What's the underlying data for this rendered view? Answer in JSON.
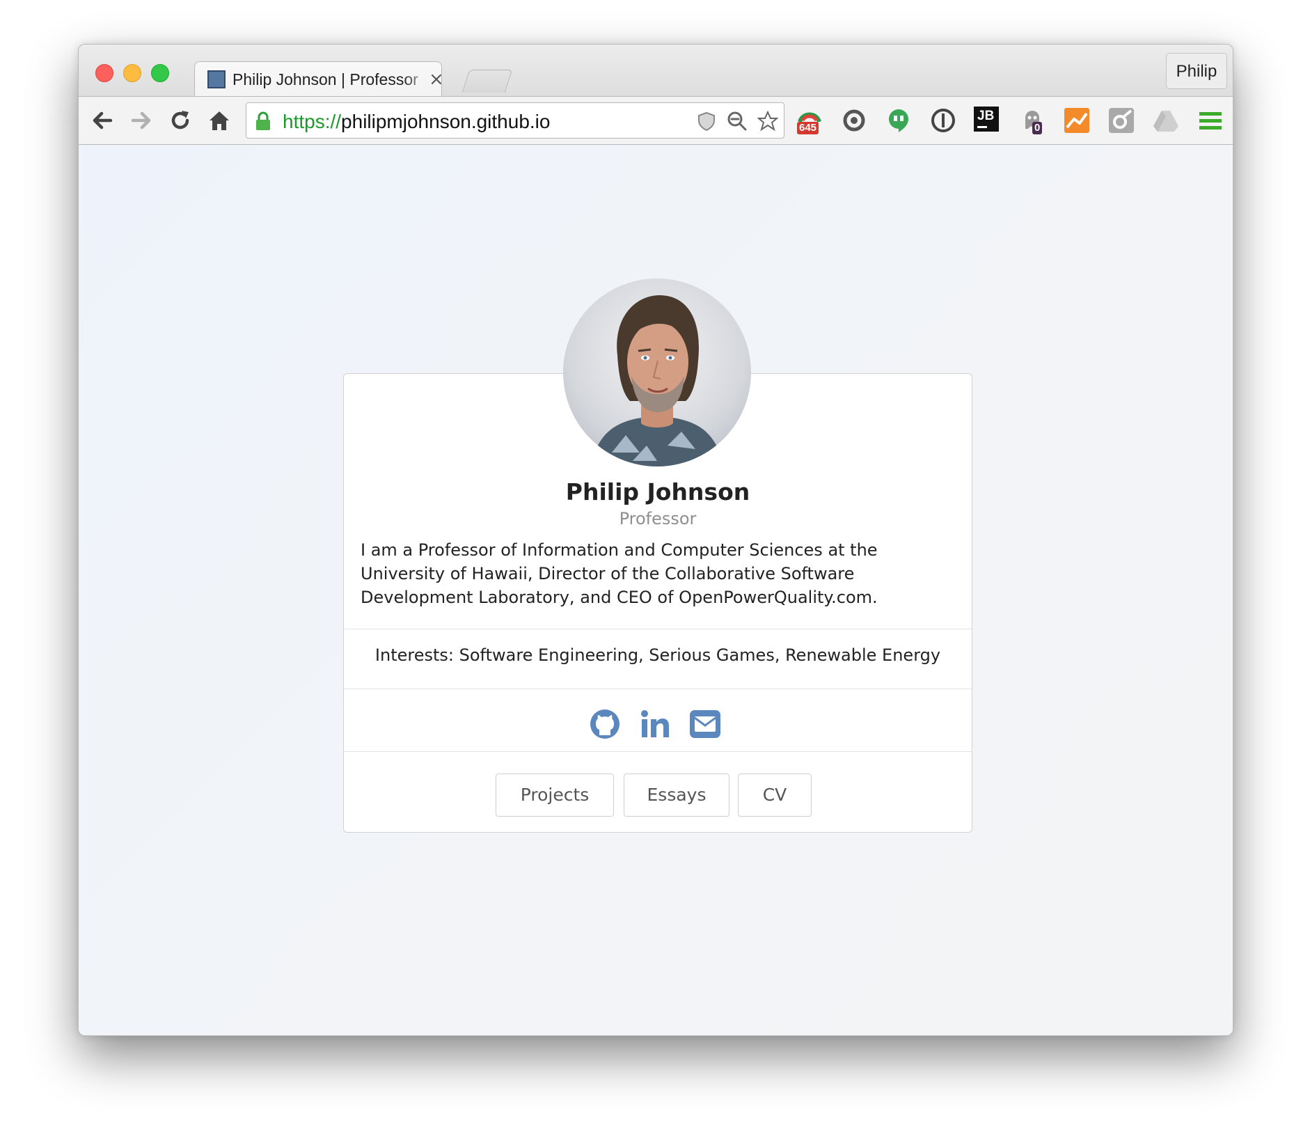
{
  "browser": {
    "tab_title": "Philip Johnson | Professor",
    "tab_close": "×",
    "profile_name": "Philip",
    "url_scheme": "https://",
    "url_host": "philipmjohnson.github.io",
    "extensions": [
      {
        "name": "extension-badge-icon",
        "badge": "645"
      },
      {
        "name": "sync-icon"
      },
      {
        "name": "hangouts-icon"
      },
      {
        "name": "onepassword-icon"
      },
      {
        "name": "jetbrains-icon",
        "label": "JB"
      },
      {
        "name": "ghostery-icon",
        "badge": "0"
      },
      {
        "name": "analytics-icon"
      },
      {
        "name": "feedly-icon"
      },
      {
        "name": "drive-icon"
      },
      {
        "name": "menu-icon"
      }
    ]
  },
  "profile": {
    "name": "Philip Johnson",
    "title": "Professor",
    "bio": "I am a Professor of Information and Computer Sciences at the University of Hawaii, Director of the Collaborative Software Development Laboratory, and CEO of OpenPowerQuality.com.",
    "interests": "Interests: Software Engineering, Serious Games, Renewable Energy",
    "social": [
      "github-icon",
      "linkedin-icon",
      "email-icon"
    ],
    "buttons": {
      "projects": "Projects",
      "essays": "Essays",
      "cv": "CV"
    }
  },
  "colors": {
    "social_icons": "#5b87bf",
    "url_scheme": "#1a9a28",
    "traffic_red": "#fc605c",
    "traffic_yellow": "#fdbc40",
    "traffic_green": "#34c84a"
  }
}
